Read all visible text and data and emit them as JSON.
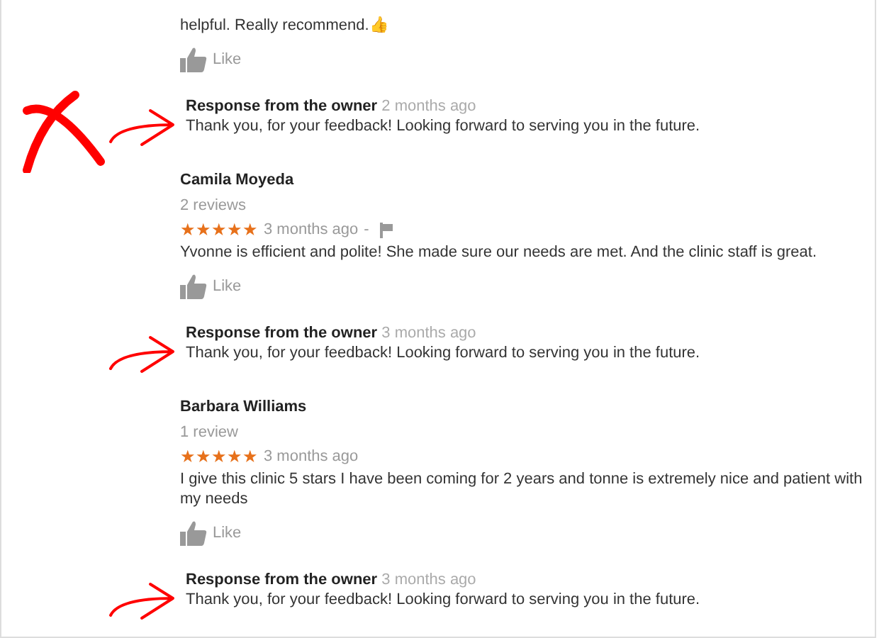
{
  "feed": [
    {
      "kind": "review",
      "text": "helpful. Really recommend.👍",
      "like_label": "Like"
    },
    {
      "kind": "response",
      "label": "Response from the owner",
      "time": "2 months ago",
      "text": "Thank you, for your feedback! Looking forward to serving you in the future.",
      "arrow": true,
      "crossed": true
    },
    {
      "kind": "review",
      "name": "Camila Moyeda",
      "count": "2 reviews",
      "stars": 5,
      "time": "3 months ago",
      "separator": "-",
      "flag": true,
      "text": "Yvonne is efficient and polite! She made sure our needs are met. And the clinic staff is great.",
      "like_label": "Like"
    },
    {
      "kind": "response",
      "label": "Response from the owner",
      "time": "3 months ago",
      "text": "Thank you, for your feedback! Looking forward to serving you in the future.",
      "arrow": true,
      "crossed": false
    },
    {
      "kind": "review",
      "name": "Barbara Williams",
      "count": "1 review",
      "stars": 5,
      "time": "3 months ago",
      "text": "I give this clinic 5 stars I have been coming for 2 years and tonne is extremely nice and patient with my needs",
      "like_label": "Like"
    },
    {
      "kind": "response",
      "label": "Response from the owner",
      "time": "3 months ago",
      "text": "Thank you, for your feedback! Looking forward to serving you in the future.",
      "arrow": true,
      "crossed": false
    }
  ]
}
